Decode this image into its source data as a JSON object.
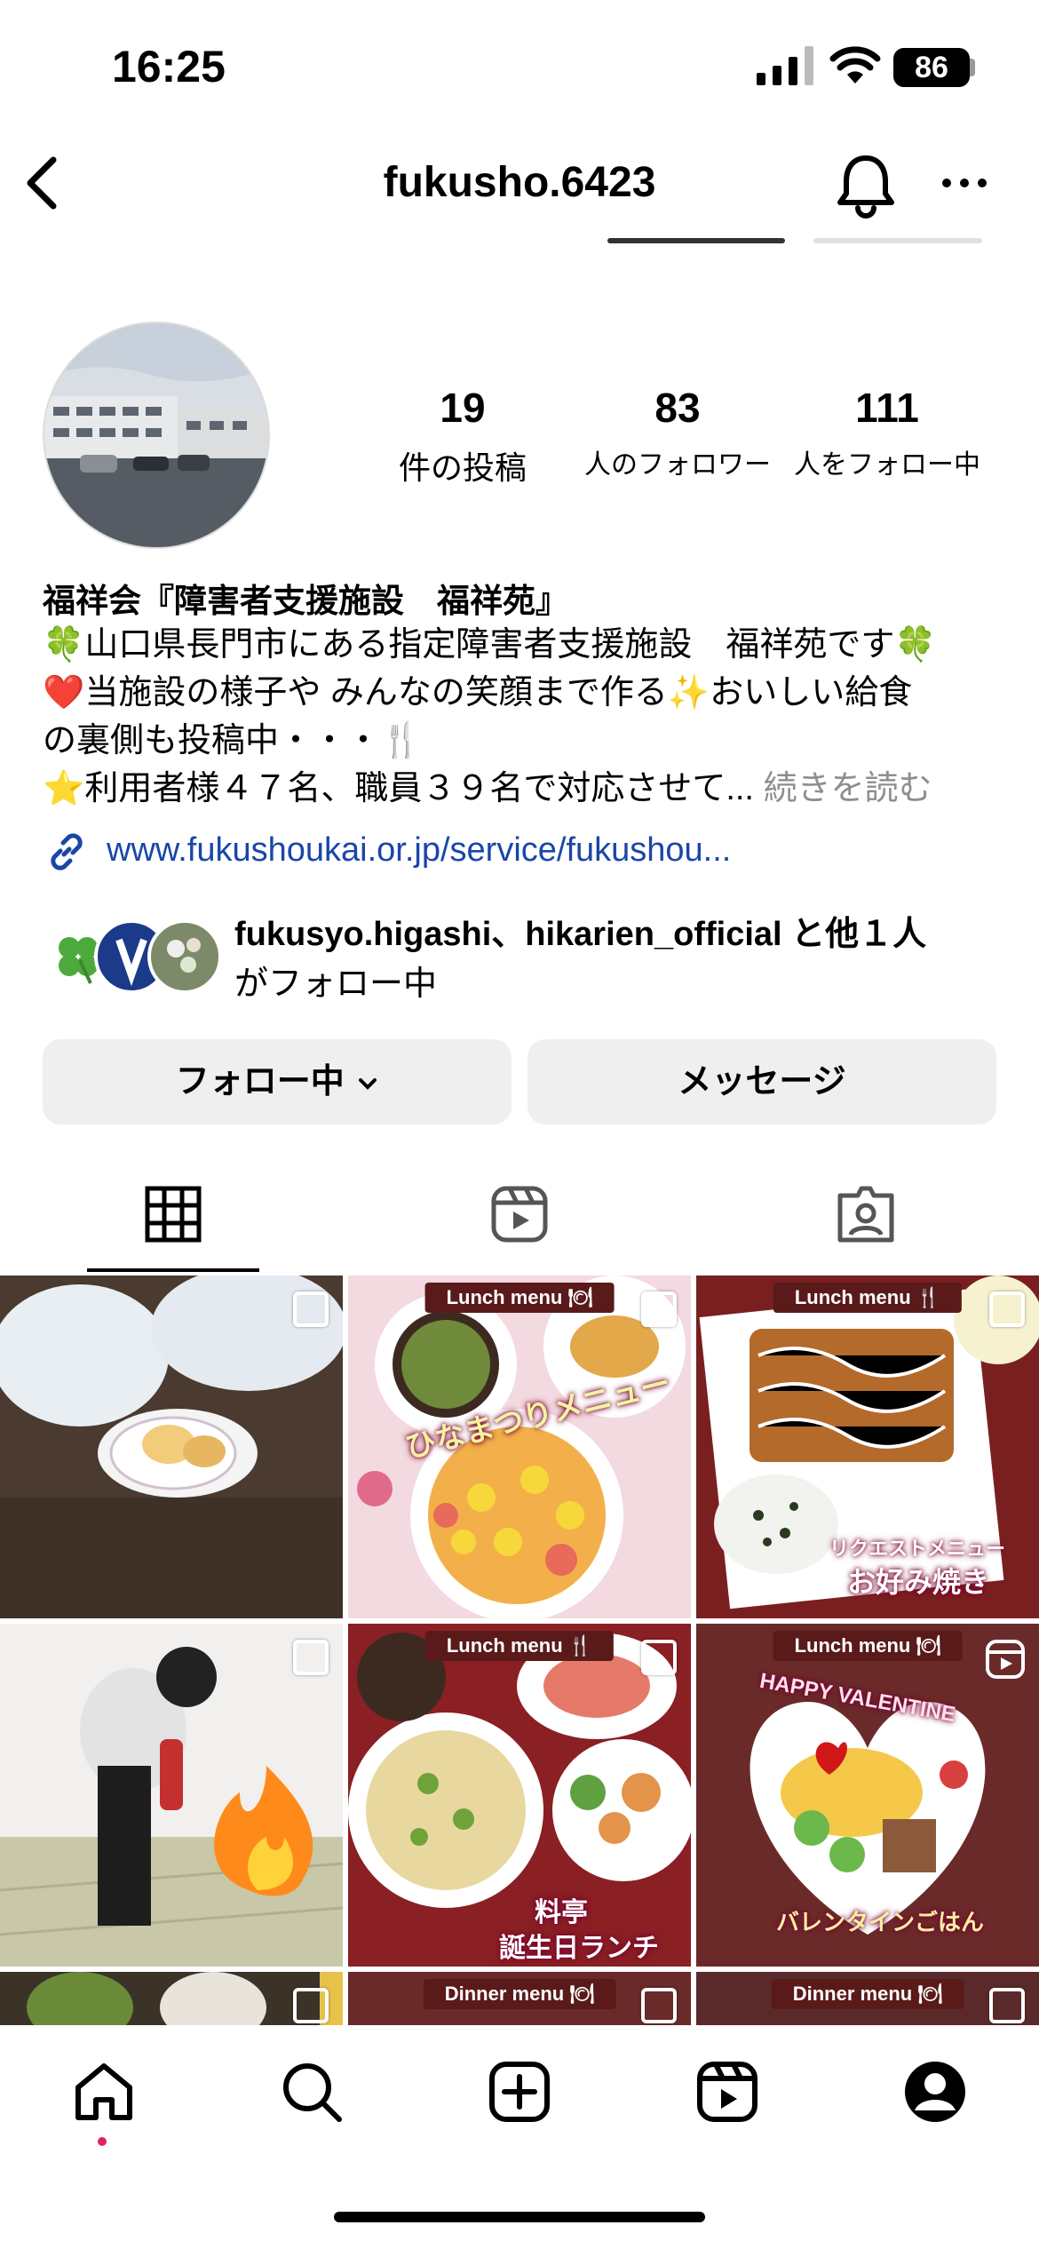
{
  "status": {
    "time": "16:25",
    "battery": "86"
  },
  "header": {
    "username": "fukusho.6423"
  },
  "profile": {
    "stats": [
      {
        "num": "19",
        "label": "件の投稿"
      },
      {
        "num": "83",
        "label": "人のフォロワー"
      },
      {
        "num": "111",
        "label": "人をフォロー中"
      }
    ],
    "name": "福祥会『障害者支援施設　福祥苑』",
    "bio": [
      "🍀山口県長門市にある指定障害者支援施設　福祥苑です🍀",
      "❤️当施設の様子や みんなの笑顔まで作る✨おいしい給食",
      "の裏側も投稿中・・・🍴",
      "⭐️利用者様４７名、職員３９名で対応させて..."
    ],
    "more_label": "続きを読む",
    "link": "www.fukushoukai.or.jp/service/fukushou...",
    "mutual_line1": "fukusyo.higashi、hikarien_official と他１人",
    "mutual_line2": "がフォロー中"
  },
  "buttons": {
    "follow": "フォロー中",
    "message": "メッセージ"
  },
  "posts": [
    {
      "label": "",
      "caption": ""
    },
    {
      "label": "Lunch menu 🍽",
      "caption": "ひなまつりメニュー"
    },
    {
      "label": "Lunch menu 🍴",
      "caption": "お好み焼き",
      "sub_caption": "リクエストメニュー"
    },
    {
      "label": "",
      "caption": ""
    },
    {
      "label": "Lunch menu 🍴",
      "caption": "料亭",
      "sub_caption": "誕生日ランチ"
    },
    {
      "label": "Lunch menu 🍽",
      "caption": "バレンタインごはん",
      "sub_caption": "HAPPY VALENTINE"
    },
    {
      "label": "",
      "caption": ""
    },
    {
      "label": "Dinner menu 🍽",
      "caption": ""
    },
    {
      "label": "Dinner menu 🍽",
      "caption": ""
    }
  ],
  "colors": {
    "link": "#1a46a8",
    "button_bg": "#efefef",
    "notification_dot": "#e0245e"
  }
}
